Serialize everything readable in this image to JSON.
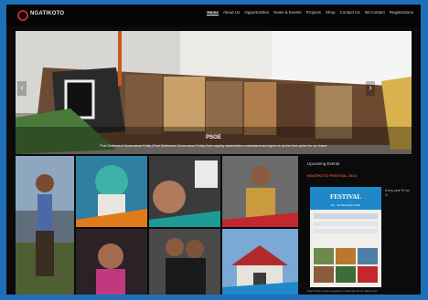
{
  "brand": {
    "name": "NGATIKOTO"
  },
  "nav": {
    "items": [
      "Home",
      "About Us",
      "Opportunities",
      "News & Events",
      "Projects",
      "Shop",
      "Contact Us",
      "Wi Contact",
      "Registrations"
    ],
    "active_index": 0
  },
  "slider": {
    "title": "PSGE",
    "text": "Post Settlement Governance Entity (Post Settlement Governance Entity) that majority stakeholders understand and agree to as the best option for our future",
    "prev": "‹",
    "next": "›"
  },
  "sidebar": {
    "heading": "Upcoming Events",
    "event_title": "NGATIKOTO FESTIVAL 2014",
    "poster_title": "FESTIVAL",
    "poster_dates": "18 – 20 December 2014",
    "side_note": "Every year Te Iwi O",
    "footer": "Ngai Tahito comes together to celebrate all our talent and"
  },
  "colors": {
    "accent": "#c2282d",
    "event_red": "#e8483d",
    "page_bg": "#1f6fb8",
    "frame_bg": "#0b0b0b"
  }
}
